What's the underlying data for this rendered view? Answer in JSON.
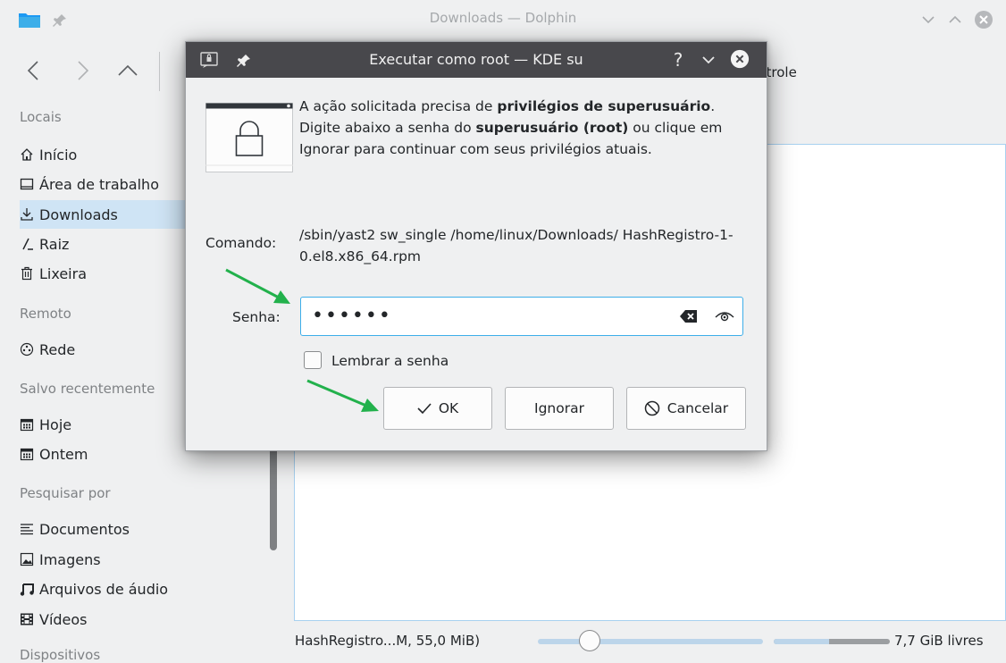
{
  "window": {
    "title": "Downloads — Dolphin"
  },
  "toolbar": {
    "control_label": "ntrole"
  },
  "sidebar": {
    "sections": [
      {
        "label": "Locais",
        "items": [
          {
            "label": "Início",
            "icon": "home-icon"
          },
          {
            "label": "Área de trabalho",
            "icon": "desktop-icon"
          },
          {
            "label": "Downloads",
            "icon": "download-icon",
            "selected": true
          },
          {
            "label": "Raiz",
            "icon": "root-folder-icon"
          },
          {
            "label": "Lixeira",
            "icon": "trash-icon"
          }
        ]
      },
      {
        "label": "Remoto",
        "items": [
          {
            "label": "Rede",
            "icon": "network-icon"
          }
        ]
      },
      {
        "label": "Salvo recentemente",
        "items": [
          {
            "label": "Hoje",
            "icon": "calendar-icon"
          },
          {
            "label": "Ontem",
            "icon": "calendar-icon"
          }
        ]
      },
      {
        "label": "Pesquisar por",
        "items": [
          {
            "label": "Documentos",
            "icon": "document-icon"
          },
          {
            "label": "Imagens",
            "icon": "image-icon"
          },
          {
            "label": "Arquivos de áudio",
            "icon": "audio-icon"
          },
          {
            "label": "Vídeos",
            "icon": "video-icon"
          }
        ]
      },
      {
        "label": "Dispositivos",
        "items": []
      }
    ]
  },
  "status": {
    "selection_text": "HashRegistro...M, 55,0 MiB)",
    "zoom_level": 0.2,
    "free_space_text": "7,7 GiB livres",
    "used_fraction": 0.48
  },
  "dialog": {
    "title": "Executar como root — KDE su",
    "message": [
      {
        "t": "A ação solicitada precisa de ",
        "b": false
      },
      {
        "t": "privilégios de superusuário",
        "b": true
      },
      {
        "t": ". Digite abaixo a senha do ",
        "b": false
      },
      {
        "t": "superusuário (root)",
        "b": true
      },
      {
        "t": " ou clique em Ignorar para continuar com seus privilégios atuais.",
        "b": false
      }
    ],
    "command_label": "Comando:",
    "command_value": "/sbin/yast2 sw_single  /home/linux/Downloads/ HashRegistro-1-0.el8.x86_64.rpm",
    "password_label": "Senha:",
    "password_masked": "••••••",
    "remember_label": "Lembrar a senha",
    "remember_checked": false,
    "ok_label": "OK",
    "ignore_label": "Ignorar",
    "cancel_label": "Cancelar",
    "help_glyph": "?"
  },
  "colors": {
    "accent": "#3daee9",
    "selection": "#cfe4f5",
    "dialog_titlebar": "#48484c",
    "annotation_arrow": "#22b14c"
  }
}
